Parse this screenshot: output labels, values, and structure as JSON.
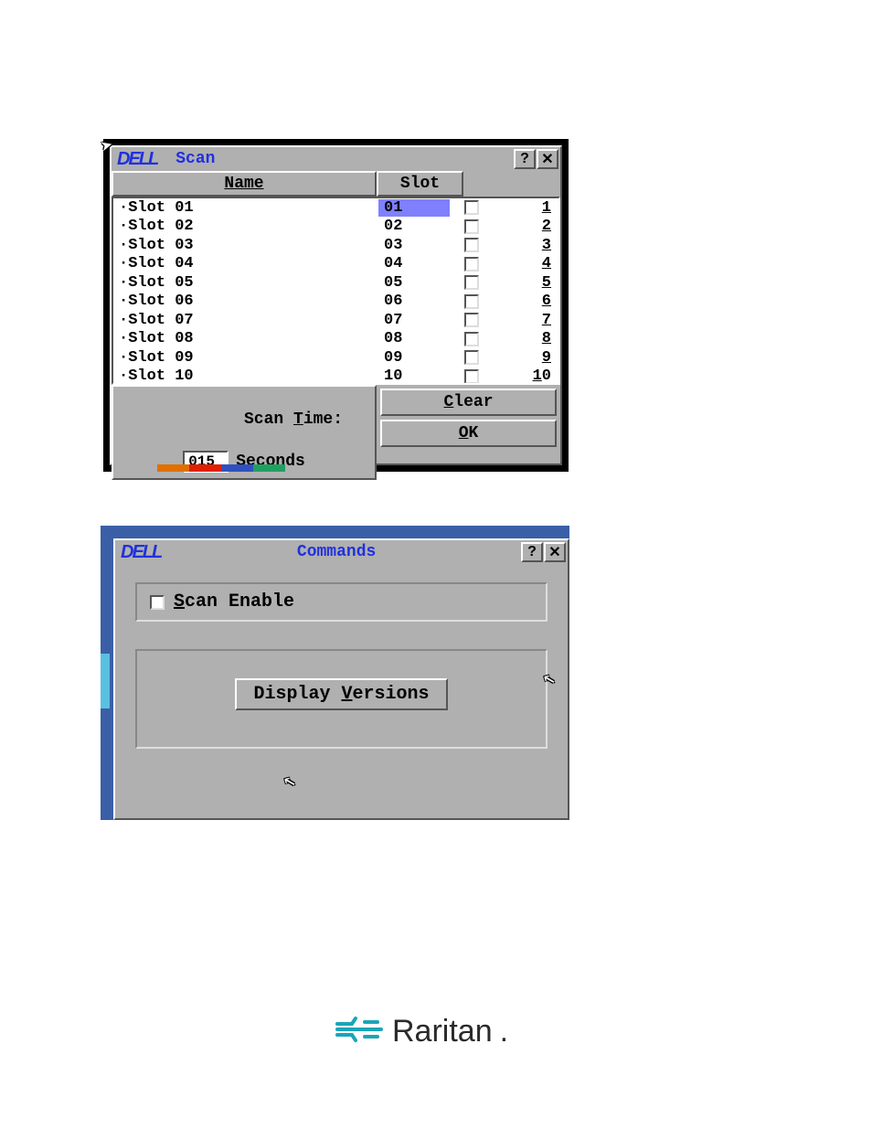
{
  "scanWindow": {
    "title": "Scan",
    "logo": "DELL",
    "headers": {
      "name": "Name",
      "slot": "Slot"
    },
    "rows": [
      {
        "name": "·Slot 01",
        "slot": "01",
        "num": "1",
        "accel": "1",
        "selected": true
      },
      {
        "name": "·Slot 02",
        "slot": "02",
        "num": "2",
        "accel": "2",
        "selected": false
      },
      {
        "name": "·Slot 03",
        "slot": "03",
        "num": "3",
        "accel": "3",
        "selected": false
      },
      {
        "name": "·Slot 04",
        "slot": "04",
        "num": "4",
        "accel": "4",
        "selected": false
      },
      {
        "name": "·Slot 05",
        "slot": "05",
        "num": "5",
        "accel": "5",
        "selected": false
      },
      {
        "name": "·Slot 06",
        "slot": "06",
        "num": "6",
        "accel": "6",
        "selected": false
      },
      {
        "name": "·Slot 07",
        "slot": "07",
        "num": "7",
        "accel": "7",
        "selected": false
      },
      {
        "name": "·Slot 08",
        "slot": "08",
        "num": "8",
        "accel": "8",
        "selected": false
      },
      {
        "name": "·Slot 09",
        "slot": "09",
        "num": "9",
        "accel": "9",
        "selected": false
      },
      {
        "name": "·Slot 10",
        "slot": "10",
        "num": "10",
        "accel": "1",
        "rest": "0",
        "selected": false
      }
    ],
    "scanTimeLabel": "Scan ",
    "scanTimeLabelAccel": "T",
    "scanTimeLabelRest": "ime:",
    "scanTimeValue": "015",
    "secondsLabel": "Seconds",
    "clearAccel": "C",
    "clearRest": "lear",
    "okAccel": "O",
    "okRest": "K"
  },
  "commandsWindow": {
    "title": "Commands",
    "logo": "DELL",
    "scanEnableAccel": "S",
    "scanEnableRest": "can Enable",
    "displayVersionsPre": "Display ",
    "displayVersionsAccel": "V",
    "displayVersionsRest": "ersions"
  },
  "footer": {
    "brand": "Raritan",
    "dot": "."
  }
}
